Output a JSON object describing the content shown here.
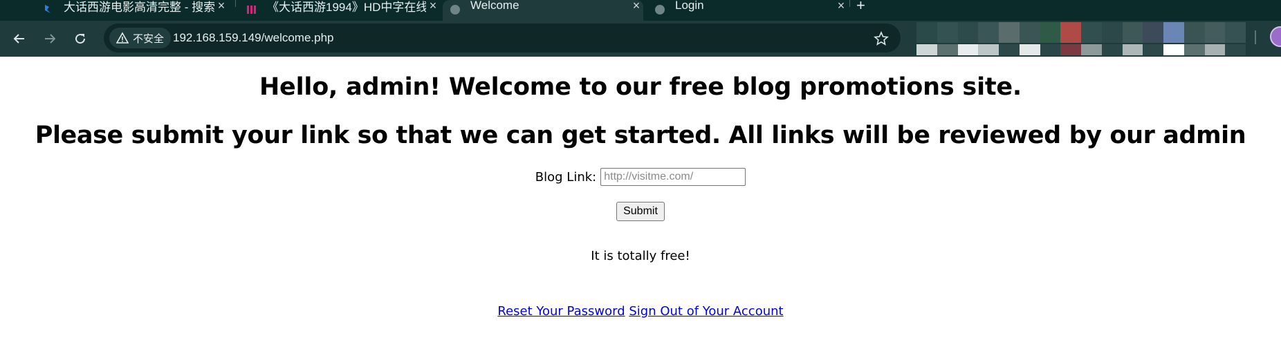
{
  "browser": {
    "tabs": [
      {
        "title": "大话西游电影高清完整 - 搜索",
        "active": false
      },
      {
        "title": "《大话西游1994》HD中字在线",
        "active": false
      },
      {
        "title": "Welcome",
        "active": true
      },
      {
        "title": "Login",
        "active": false
      }
    ],
    "new_tab_label": "+",
    "security_label": "不安全",
    "url": "192.168.159.149/welcome.php"
  },
  "page": {
    "heading_welcome": "Hello, admin! Welcome to our free blog promotions site.",
    "heading_submit": "Please submit your link so that we can get started. All links will be reviewed by our admin",
    "blog_link_label": "Blog Link:",
    "blog_link_placeholder": "http://visitme.com/",
    "blog_link_value": "",
    "submit_label": "Submit",
    "free_text": "It is totally free!",
    "reset_password_link": "Reset Your Password",
    "sign_out_link": "Sign Out of Your Account"
  },
  "icons": {
    "back": "back-arrow-icon",
    "forward": "forward-arrow-icon",
    "reload": "reload-icon",
    "warning": "warning-triangle-icon",
    "bookmark": "star-icon",
    "profile": "profile-avatar"
  },
  "colors": {
    "tabbar_bg": "#0b2a2a",
    "toolbar_bg": "#1f3b3b",
    "omnibox_bg": "#0f2727",
    "link": "#0000ee"
  }
}
